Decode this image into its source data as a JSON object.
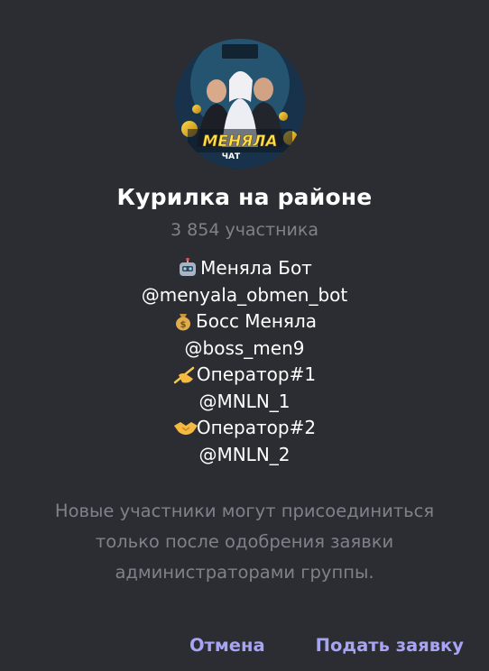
{
  "group": {
    "title": "Курилка на районе",
    "members": "3 854 участника",
    "avatar_text": "МЕНЯЛА ЧАТ"
  },
  "description": [
    {
      "icon": "robot-icon",
      "text": "Меняла Бот"
    },
    {
      "icon": "",
      "text": "@menyala_obmen_bot"
    },
    {
      "icon": "money-bag-icon",
      "text": "Босс Меняла"
    },
    {
      "icon": "",
      "text": "@boss_men9"
    },
    {
      "icon": "writing-hand-icon",
      "text": "Оператор#1"
    },
    {
      "icon": "",
      "text": "@MNLN_1"
    },
    {
      "icon": "handshake-icon",
      "text": "Оператор#2"
    },
    {
      "icon": "",
      "text": "@MNLN_2"
    }
  ],
  "notice": {
    "line1": "Новые участники могут присоединиться",
    "line2": "только после одобрения заявки",
    "line3": "администраторами группы."
  },
  "buttons": {
    "cancel": "Отмена",
    "apply": "Подать заявку"
  },
  "colors": {
    "background": "#2b2d33",
    "accent": "#a7a4f3",
    "muted": "#7e8289"
  }
}
